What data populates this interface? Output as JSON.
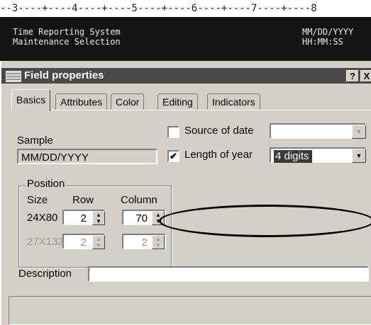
{
  "terminal": {
    "ruler": "--3----+----4----+----5----+----6----+----7----+----8",
    "app_title": "Time Reporting System",
    "screen_title": "Maintenance Selection",
    "date_format": "MM/DD/YYYY",
    "time_format": "HH:MM:SS"
  },
  "dialog": {
    "title": "Field properties",
    "help_label": "?",
    "close_label": "X",
    "tabs": [
      "Basics",
      "Attributes",
      "Color",
      "Editing",
      "Indicators"
    ],
    "active_tab": "Basics"
  },
  "sample": {
    "label": "Sample",
    "value": "MM/DD/YYYY"
  },
  "source_of_date": {
    "label": "Source of date",
    "checked": false,
    "value": ""
  },
  "length_of_year": {
    "label": "Length of year",
    "checked": true,
    "check_glyph": "✔",
    "value": "4 digits"
  },
  "position": {
    "group_label": "Position",
    "size_label": "Size",
    "row_label": "Row",
    "column_label": "Column",
    "rows": [
      {
        "size": "24X80",
        "row": "2",
        "column": "70",
        "enabled": true
      },
      {
        "size": "27X132",
        "row": "2",
        "column": "2",
        "enabled": false
      }
    ]
  },
  "description": {
    "label": "Description",
    "value": ""
  },
  "icons": {
    "dropdown": "chevron-down-icon",
    "spin_up": "▲",
    "spin_down": "▼",
    "combo_arrow": "▼"
  },
  "colors": {
    "titlebar": "#4a4a4a",
    "terminal_bg": "#141414",
    "dialog_bg": "#d4d0c8",
    "highlight": "#3a3a3a"
  }
}
